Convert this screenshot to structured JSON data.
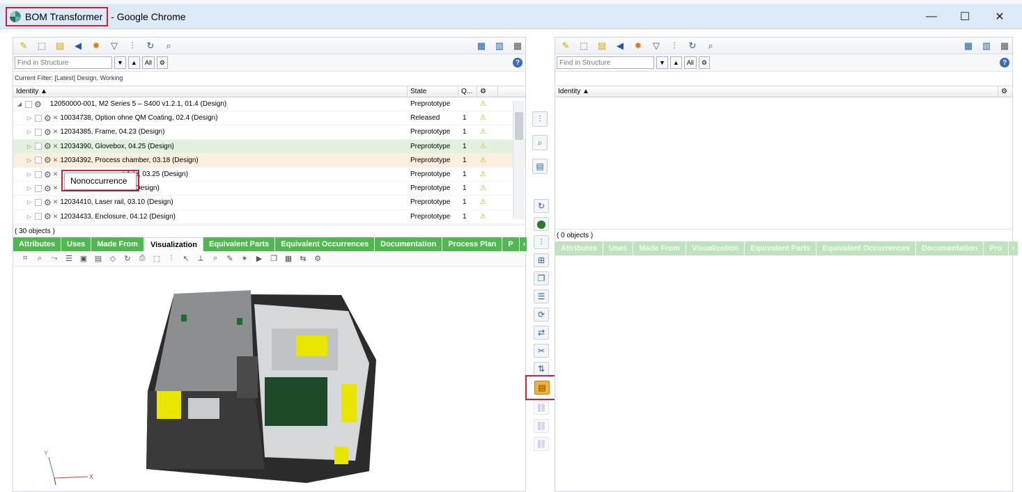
{
  "window": {
    "app_title": "BOM Transformer",
    "title_suffix": " - Google Chrome",
    "minimize": "—",
    "maximize": "☐",
    "close": "✕"
  },
  "left": {
    "find_placeholder": "Find in Structure",
    "all_label": "All",
    "filter_text": "Current Filter: [Latest] Design, Working",
    "columns": {
      "identity": "Identity ▲",
      "state": "State",
      "qty": "Q..."
    },
    "rows": [
      {
        "expander": "◢",
        "label": "12050000-001, M2 Series 5 – S400 v1.2.1, 01.4 (Design)",
        "state": "Preprototype",
        "qty": "",
        "warn": "⚠"
      },
      {
        "expander": "▷",
        "label": "10034738, Option ohne QM Coating, 02.4 (Design)",
        "state": "Released",
        "qty": "1",
        "warn": "⚠"
      },
      {
        "expander": "▷",
        "label": "12034385, Frame, 04.23 (Design)",
        "state": "Preprototype",
        "qty": "1",
        "warn": "⚠"
      },
      {
        "expander": "▷",
        "label": "12034390, Glovebox, 04.25 (Design)",
        "state": "Preprototype",
        "qty": "1",
        "warn": "⚠"
      },
      {
        "expander": "▷",
        "label": "12034392, Process chamber, 03.18 (Design)",
        "state": "Preprototype",
        "qty": "1",
        "warn": "⚠"
      },
      {
        "expander": "▷",
        "label": "odule, 03.25 (Design)",
        "state": "Preprototype",
        "qty": "1",
        "warn": "⚠"
      },
      {
        "expander": "▷",
        "label": ".12 (Design)",
        "state": "Preprototype",
        "qty": "1",
        "warn": "⚠"
      },
      {
        "expander": "▷",
        "label": "12034410, Laser rail, 03.10 (Design)",
        "state": "Preprototype",
        "qty": "1",
        "warn": "⚠"
      },
      {
        "expander": "▷",
        "label": "12034433, Enclosure, 04.12 (Design)",
        "state": "Preprototype",
        "qty": "1",
        "warn": "⚠"
      }
    ],
    "object_count": "( 30 objects )",
    "tabs": [
      "Attributes",
      "Uses",
      "Made From",
      "Visualization",
      "Equivalent Parts",
      "Equivalent Occurrences",
      "Documentation",
      "Process Plan",
      "P"
    ],
    "tooltip": "Nonoccurrence",
    "axis_y": "Y",
    "axis_x": "X"
  },
  "right": {
    "find_placeholder": "Find in Structure",
    "all_label": "All",
    "columns": {
      "identity": "Identity ▲"
    },
    "object_count": "( 0 objects )",
    "tabs": [
      "Attributes",
      "Uses",
      "Made From",
      "Visualization",
      "Equivalent Parts",
      "Equivalent Occurrences",
      "Documentation",
      "Pro"
    ]
  },
  "colors": {
    "tab_green": "#4fb84f",
    "highlight_red": "#d32030",
    "row_green": "#e2f1df",
    "row_orange": "#fbeedd"
  }
}
